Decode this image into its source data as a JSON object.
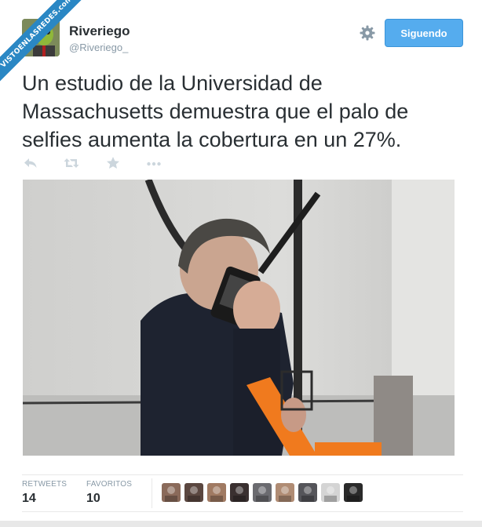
{
  "watermark": {
    "text": "VISTOENLASREDES.com"
  },
  "user": {
    "name": "Riveriego",
    "handle": "@Riveriego_"
  },
  "follow_button": {
    "label": "Siguendo"
  },
  "tweet": {
    "text": "Un estudio de la Universidad de Massachusetts demuestra que el palo de selfies aumenta la cobertura en un 27%."
  },
  "actions": {
    "icons": [
      "reply-icon",
      "retweet-icon",
      "favorite-icon",
      "more-icon"
    ]
  },
  "stats": {
    "retweets_label": "RETWEETS",
    "retweets_value": "14",
    "favorites_label": "FAVORITOS",
    "favorites_value": "10"
  },
  "favoriters_count": 9,
  "colors": {
    "follow_button": "#55acee",
    "watermark": "#2a87c4",
    "text": "#292f33",
    "muted": "#8899a6",
    "icon": "#ccd6dd"
  }
}
